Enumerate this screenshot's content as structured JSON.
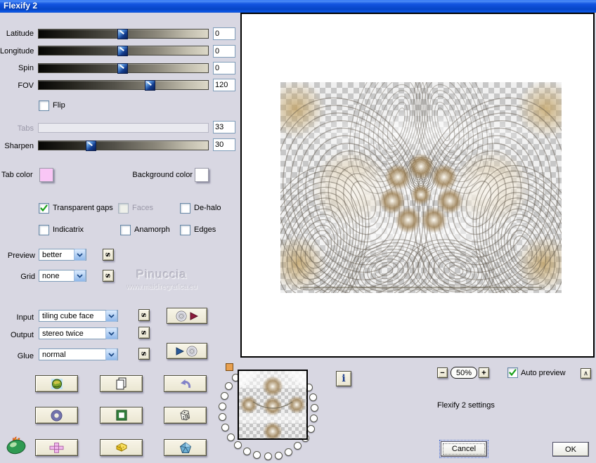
{
  "window": {
    "title": "Flexify 2"
  },
  "sliders": {
    "latitude": {
      "label": "Latitude",
      "value": "0"
    },
    "longitude": {
      "label": "Longitude",
      "value": "0"
    },
    "spin": {
      "label": "Spin",
      "value": "0"
    },
    "fov": {
      "label": "FOV",
      "value": "120"
    },
    "tabs": {
      "label": "Tabs",
      "value": "33"
    },
    "sharpen": {
      "label": "Sharpen",
      "value": "30"
    }
  },
  "checkboxes": {
    "flip": "Flip",
    "transparent_gaps": "Transparent gaps",
    "faces": "Faces",
    "de_halo": "De-halo",
    "indicatrix": "Indicatrix",
    "anamorph": "Anamorph",
    "edges": "Edges",
    "auto_preview": "Auto preview"
  },
  "colors": {
    "tab_color_label": "Tab color",
    "tab_color": "#f9c6f6",
    "background_color_label": "Background color",
    "background_color": "#ffffff"
  },
  "dropdowns": {
    "preview": {
      "label": "Preview",
      "value": "better"
    },
    "grid": {
      "label": "Grid",
      "value": "none"
    },
    "input": {
      "label": "Input",
      "value": "tiling cube face"
    },
    "output": {
      "label": "Output",
      "value": "stereo twice"
    },
    "glue": {
      "label": "Glue",
      "value": "normal"
    }
  },
  "watermark": {
    "line1": "Pinuccia",
    "line2": "www.maidiregrafica.eu"
  },
  "zoom": {
    "minus": "−",
    "value": "50%",
    "plus": "+"
  },
  "misc": {
    "s": "s",
    "info": "i",
    "caret": "∧",
    "settings_text": "Flexify 2 settings"
  },
  "buttons": {
    "cancel": "Cancel",
    "ok": "OK"
  }
}
